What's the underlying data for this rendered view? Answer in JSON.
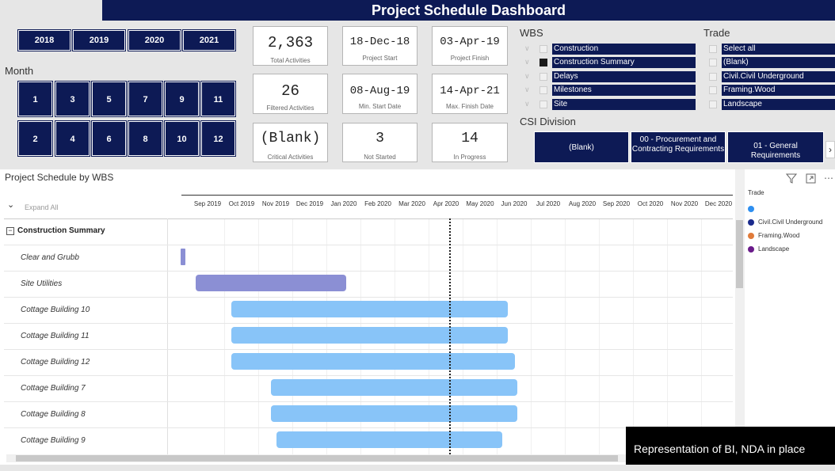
{
  "header": {
    "title": "Project Schedule Dashboard"
  },
  "years": [
    "2018",
    "2019",
    "2020",
    "2021"
  ],
  "month_label": "Month",
  "months": [
    "1",
    "3",
    "5",
    "7",
    "9",
    "11",
    "2",
    "4",
    "6",
    "8",
    "10",
    "12"
  ],
  "cards": {
    "total_activities": {
      "value": "2,363",
      "label": "Total Activities"
    },
    "project_start": {
      "value": "18-Dec-18",
      "label": "Project Start"
    },
    "project_finish": {
      "value": "03-Apr-19",
      "label": "Project Finish"
    },
    "filtered_activities": {
      "value": "26",
      "label": "Filtered Activities"
    },
    "min_start": {
      "value": "08-Aug-19",
      "label": "Min. Start Date"
    },
    "max_finish": {
      "value": "14-Apr-21",
      "label": "Max. Finish Date"
    },
    "critical_activities": {
      "value": "(Blank)",
      "label": "Critical Activities"
    },
    "not_started": {
      "value": "3",
      "label": "Not Started"
    },
    "in_progress": {
      "value": "14",
      "label": "In Progress"
    }
  },
  "wbs": {
    "title": "WBS",
    "items": [
      {
        "label": "Construction",
        "checked": false
      },
      {
        "label": "Construction Summary",
        "checked": true
      },
      {
        "label": "Delays",
        "checked": false
      },
      {
        "label": "Milestones",
        "checked": false
      },
      {
        "label": "Site",
        "checked": false
      }
    ]
  },
  "trade": {
    "title": "Trade",
    "items": [
      "Select all",
      "(Blank)",
      "Civil.Civil Underground",
      "Framing.Wood",
      "Landscape"
    ]
  },
  "csi": {
    "title": "CSI Division",
    "buttons": [
      "(Blank)",
      "00 - Procurement and Contracting Requirements",
      "01 - General Requirements"
    ]
  },
  "visual": {
    "title": "Project Schedule by WBS",
    "expand_all": "Expand All",
    "group": "Construction Summary",
    "timeline": [
      "Sep 2019",
      "Oct 2019",
      "Nov 2019",
      "Dec 2019",
      "Jan 2020",
      "Feb 2020",
      "Mar 2020",
      "Apr 2020",
      "May 2020",
      "Jun 2020",
      "Jul 2020",
      "Aug 2020",
      "Sep 2020",
      "Oct 2020",
      "Nov 2020",
      "Dec 2020"
    ],
    "legend_title": "Trade",
    "legend": [
      {
        "label": "",
        "color": "#2e8ff0"
      },
      {
        "label": "Civil.Civil Underground",
        "color": "#1a2a8c"
      },
      {
        "label": "Framing.Wood",
        "color": "#e07b3a"
      },
      {
        "label": "Landscape",
        "color": "#6a1b8a"
      }
    ],
    "rows": [
      {
        "label": "Clear and Grubb",
        "color": "#8b8fd4"
      },
      {
        "label": "Site Utilities",
        "color": "#8b8fd4"
      },
      {
        "label": "Cottage Building 10",
        "color": "#88c4f8"
      },
      {
        "label": "Cottage Building 11",
        "color": "#88c4f8"
      },
      {
        "label": "Cottage Building 12",
        "color": "#88c4f8"
      },
      {
        "label": "Cottage Building 7",
        "color": "#88c4f8"
      },
      {
        "label": "Cottage Building 8",
        "color": "#88c4f8"
      },
      {
        "label": "Cottage Building 9",
        "color": "#88c4f8"
      }
    ]
  },
  "footer_note": "Representation of BI, NDA in place"
}
